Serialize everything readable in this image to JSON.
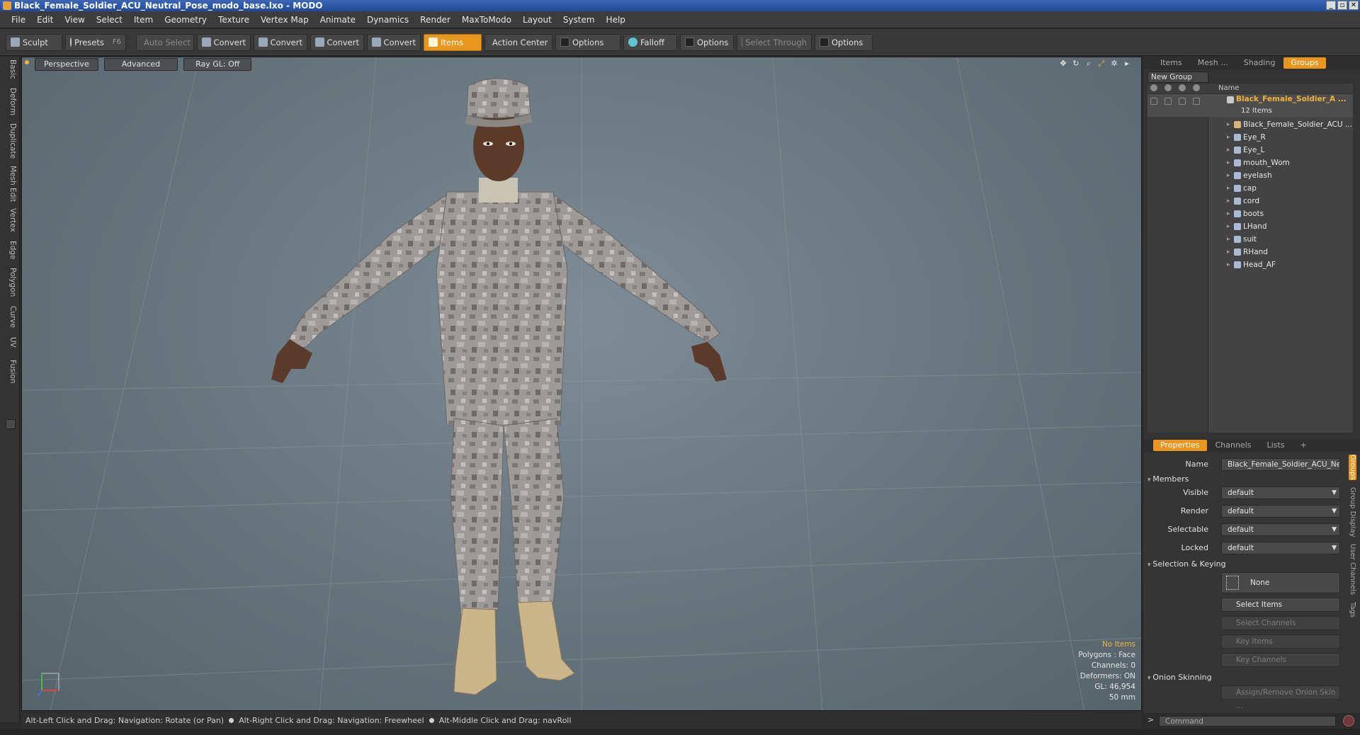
{
  "window": {
    "title": "Black_Female_Soldier_ACU_Neutral_Pose_modo_base.lxo - MODO",
    "controls": [
      "_",
      "▫",
      "✕"
    ]
  },
  "menu": [
    "File",
    "Edit",
    "View",
    "Select",
    "Item",
    "Geometry",
    "Texture",
    "Vertex Map",
    "Animate",
    "Dynamics",
    "Render",
    "MaxToModo",
    "Layout",
    "System",
    "Help"
  ],
  "toolbar": {
    "sculpt": "Sculpt",
    "presets": "Presets",
    "presets_key": "F6",
    "auto_select": "Auto Select",
    "convert1": "Convert",
    "convert2": "Convert",
    "convert3": "Convert",
    "convert4": "Convert",
    "items": "Items",
    "action_center": "Action Center",
    "options1": "Options",
    "falloff": "Falloff",
    "options2": "Options",
    "select_through": "Select Through",
    "options3": "Options"
  },
  "left_tabs": [
    "Basic",
    "Deform",
    "Duplicate",
    "Mesh Edit",
    "Vertex",
    "Edge",
    "Polygon",
    "Curve",
    "UV",
    "Fusion"
  ],
  "viewport": {
    "view": "Perspective",
    "shading": "Advanced",
    "raygl": "Ray GL: Off",
    "stats": {
      "selection": "No Items",
      "polygons": "Polygons : Face",
      "channels": "Channels: 0",
      "deformers": "Deformers: ON",
      "gl": "GL: 46,954",
      "scale": "50 mm"
    }
  },
  "status": {
    "hint1": "Alt-Left Click and Drag: Navigation: Rotate (or Pan)",
    "hint2": "Alt-Right Click and Drag: Navigation: Freewheel",
    "hint3": "Alt-Middle Click and Drag: navRoll"
  },
  "right_panel": {
    "top_tabs": [
      "Items",
      "Mesh ...",
      "Shading",
      "Groups"
    ],
    "new_group": "New Group",
    "list_header": "Name",
    "group": {
      "name": "Black_Female_Soldier_A ...",
      "count": "12 Items"
    },
    "items": [
      "Black_Female_Soldier_ACU ...",
      "Eye_R",
      "Eye_L",
      "mouth_Wom",
      "eyelash",
      "cap",
      "cord",
      "boots",
      "LHand",
      "suit",
      "RHand",
      "Head_AF"
    ],
    "prop_tabs": [
      "Properties",
      "Channels",
      "Lists",
      "+"
    ],
    "props": {
      "name_label": "Name",
      "name_value": "Black_Female_Soldier_ACU_Neut",
      "members": "Members",
      "visible_label": "Visible",
      "visible": "default",
      "render_label": "Render",
      "render": "default",
      "selectable_label": "Selectable",
      "selectable": "default",
      "locked_label": "Locked",
      "locked": "default",
      "sel_keying": "Selection & Keying",
      "none": "None",
      "select_items": "Select Items",
      "select_channels": "Select Channels",
      "key_items": "Key Items",
      "key_channels": "Key Channels",
      "onion": "Onion Skinning",
      "assign_onion": "Assign/Remove Onion Skin ..."
    },
    "side_tabs": [
      "Groups",
      "Group Display",
      "User Channels",
      "Tags"
    ],
    "command_placeholder": "Command",
    "command_prompt": ">"
  },
  "colors": {
    "accent": "#e8961e",
    "highlight_text": "#f3b23c",
    "viewport_bg": "#6c7a83"
  }
}
